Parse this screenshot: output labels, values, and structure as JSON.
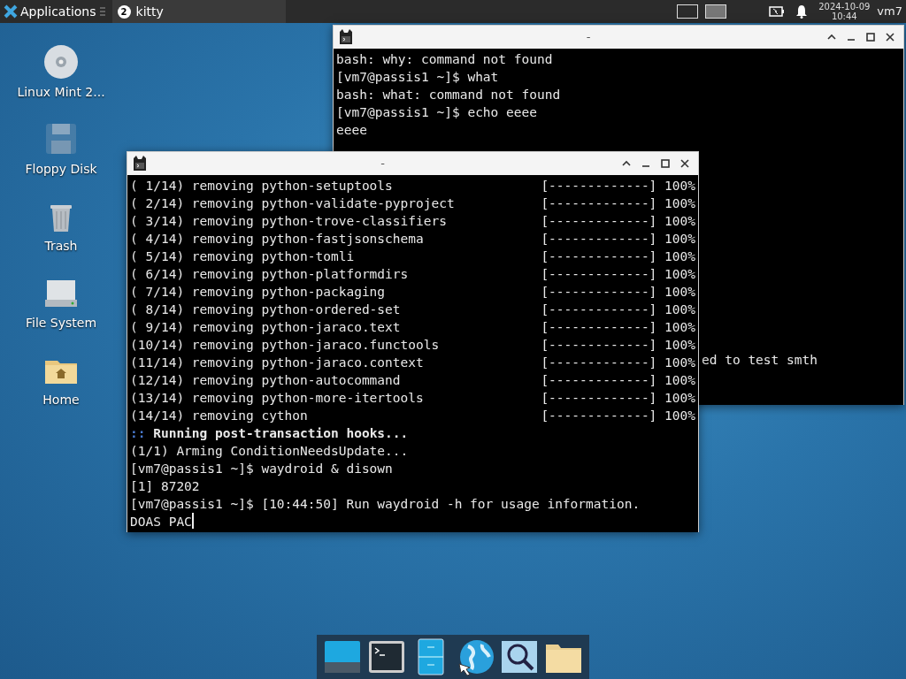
{
  "top_panel": {
    "menu_label": "Applications",
    "task": {
      "badge": "2",
      "label": "kitty",
      "selected": true
    },
    "workspaces": [
      {
        "selected": false
      },
      {
        "selected": true
      }
    ],
    "date": "2024-10-09",
    "time": "10:44",
    "user": "vm7"
  },
  "desktop_icons": [
    {
      "kind": "disc",
      "label": "Linux Mint 2..."
    },
    {
      "kind": "floppy",
      "label": "Floppy Disk"
    },
    {
      "kind": "trash",
      "label": "Trash"
    },
    {
      "kind": "drive",
      "label": "File System"
    },
    {
      "kind": "home",
      "label": "Home"
    }
  ],
  "windows": [
    {
      "title": "-",
      "lines": [
        {
          "kind": "plain",
          "text": "bash: why: command not found"
        },
        {
          "kind": "plain",
          "text": "[vm7@passis1 ~]$ what"
        },
        {
          "kind": "plain",
          "text": "bash: what: command not found"
        },
        {
          "kind": "plain",
          "text": "[vm7@passis1 ~]$ echo eeee"
        },
        {
          "kind": "plain",
          "text": "eeee"
        },
        {
          "kind": "offset",
          "text": "ed to test smth"
        }
      ]
    },
    {
      "title": "-",
      "lines": [
        {
          "kind": "progress",
          "text": "( 1/14) removing python-setuptools",
          "progress": "[-------------] 100%"
        },
        {
          "kind": "progress",
          "text": "( 2/14) removing python-validate-pyproject",
          "progress": "[-------------] 100%"
        },
        {
          "kind": "progress",
          "text": "( 3/14) removing python-trove-classifiers",
          "progress": "[-------------] 100%"
        },
        {
          "kind": "progress",
          "text": "( 4/14) removing python-fastjsonschema",
          "progress": "[-------------] 100%"
        },
        {
          "kind": "progress",
          "text": "( 5/14) removing python-tomli",
          "progress": "[-------------] 100%"
        },
        {
          "kind": "progress",
          "text": "( 6/14) removing python-platformdirs",
          "progress": "[-------------] 100%"
        },
        {
          "kind": "progress",
          "text": "( 7/14) removing python-packaging",
          "progress": "[-------------] 100%"
        },
        {
          "kind": "progress",
          "text": "( 8/14) removing python-ordered-set",
          "progress": "[-------------] 100%"
        },
        {
          "kind": "progress",
          "text": "( 9/14) removing python-jaraco.text",
          "progress": "[-------------] 100%"
        },
        {
          "kind": "progress",
          "text": "(10/14) removing python-jaraco.functools",
          "progress": "[-------------] 100%"
        },
        {
          "kind": "progress",
          "text": "(11/14) removing python-jaraco.context",
          "progress": "[-------------] 100%"
        },
        {
          "kind": "progress",
          "text": "(12/14) removing python-autocommand",
          "progress": "[-------------] 100%"
        },
        {
          "kind": "progress",
          "text": "(13/14) removing python-more-itertools",
          "progress": "[-------------] 100%"
        },
        {
          "kind": "progress",
          "text": "(14/14) removing cython",
          "progress": "[-------------] 100%"
        },
        {
          "kind": "hook",
          "prefix": "::",
          "text": "Running post-transaction hooks..."
        },
        {
          "kind": "plain",
          "text": "(1/1) Arming ConditionNeedsUpdate..."
        },
        {
          "kind": "plain",
          "text": "[vm7@passis1 ~]$ waydroid & disown"
        },
        {
          "kind": "plain",
          "text": "[1] 87202"
        },
        {
          "kind": "plain",
          "text": "[vm7@passis1 ~]$ [10:44:50] Run waydroid -h for usage information."
        },
        {
          "kind": "input",
          "text": "DOAS PAC"
        }
      ]
    }
  ],
  "dock": [
    {
      "kind": "desktop"
    },
    {
      "kind": "terminal"
    },
    {
      "kind": "files"
    },
    {
      "kind": "browser"
    },
    {
      "kind": "search"
    },
    {
      "kind": "folder"
    }
  ]
}
